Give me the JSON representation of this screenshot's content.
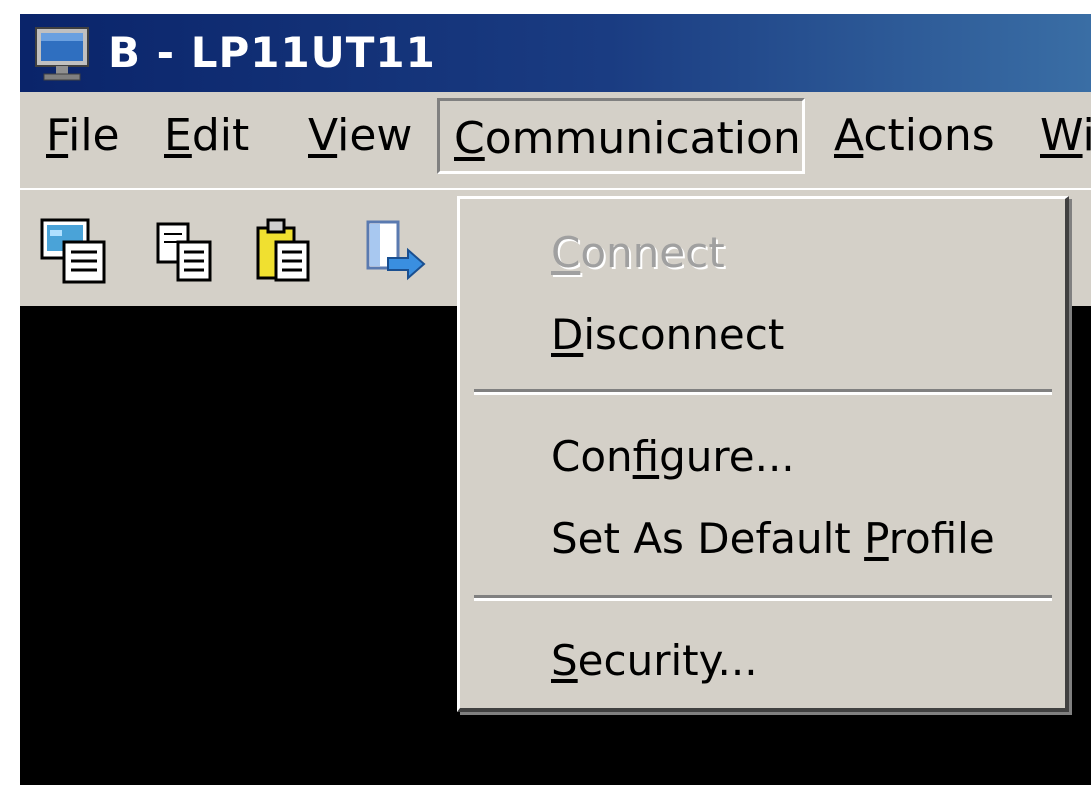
{
  "window": {
    "title": "B - LP11UT11",
    "icon": "monitor-icon"
  },
  "menubar": {
    "items": [
      {
        "id": "file",
        "label": "File",
        "mnemonic": "F"
      },
      {
        "id": "edit",
        "label": "Edit",
        "mnemonic": "E"
      },
      {
        "id": "view",
        "label": "View",
        "mnemonic": "V"
      },
      {
        "id": "communication",
        "label": "Communication",
        "mnemonic": "C",
        "open": true
      },
      {
        "id": "actions",
        "label": "Actions",
        "mnemonic": "A"
      },
      {
        "id": "window",
        "label": "Wi",
        "mnemonic": "W",
        "truncated": true
      }
    ]
  },
  "toolbar": {
    "buttons": [
      {
        "icon": "print-screen-icon"
      },
      {
        "icon": "copy-icon"
      },
      {
        "icon": "paste-icon"
      },
      {
        "icon": "send-file-icon"
      }
    ]
  },
  "communication_menu": {
    "items": [
      {
        "label": "Connect",
        "mnemonic": "C",
        "enabled": false
      },
      {
        "label": "Disconnect",
        "mnemonic": "D",
        "enabled": true
      },
      {
        "separator": true
      },
      {
        "label": "Configure...",
        "mnemonic": "f",
        "enabled": true
      },
      {
        "label": "Set As Default Profile",
        "mnemonic": "P",
        "enabled": true
      },
      {
        "separator": true
      },
      {
        "label": "Security...",
        "mnemonic": "S",
        "enabled": true
      }
    ]
  },
  "colors": {
    "title_bar": "#0a246a",
    "face": "#d4d0c8",
    "terminal_bg": "#000000",
    "disabled_text": "#a0a0a0"
  }
}
